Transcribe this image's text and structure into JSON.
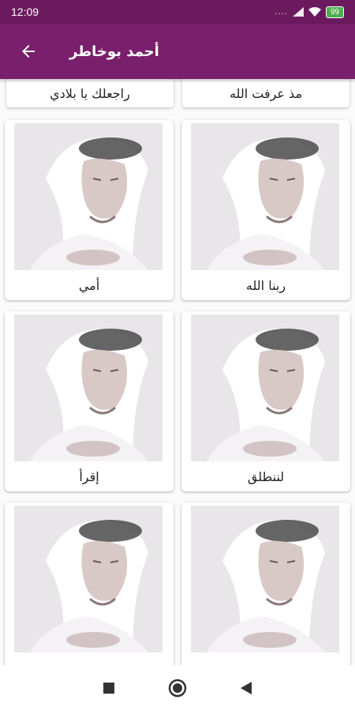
{
  "status_bar": {
    "time": "12:09",
    "signal_dots": "....",
    "battery": "99"
  },
  "app_bar": {
    "title": "أحمد بوخاطر",
    "back_icon": "arrow-left-icon"
  },
  "partial_row": [
    {
      "label": "مذ عرفت الله"
    },
    {
      "label": "راجعلك يا بلادي"
    }
  ],
  "cards": [
    {
      "label": "ربنا الله"
    },
    {
      "label": "أمي"
    },
    {
      "label": "لننطلق"
    },
    {
      "label": "إقرأ"
    },
    {
      "label": ""
    },
    {
      "label": ""
    }
  ],
  "nav_bar": {
    "recent_icon": "square-icon",
    "home_icon": "circle-icon",
    "back_icon": "triangle-back-icon"
  },
  "colors": {
    "status": "#6b1a5e",
    "app_bar": "#7a1f6c",
    "card": "#ffffff",
    "background": "#fafafa"
  }
}
